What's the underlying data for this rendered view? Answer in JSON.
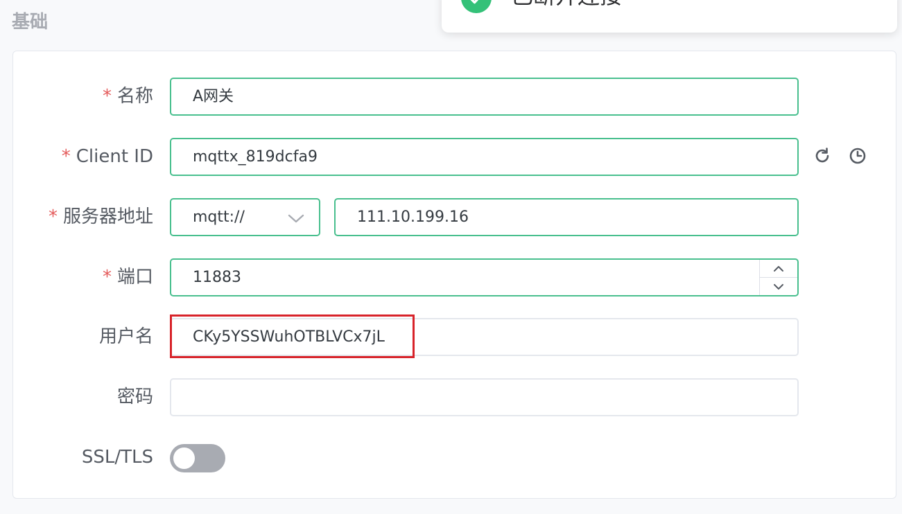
{
  "section": {
    "title": "基础"
  },
  "toast": {
    "message": "已断开连接",
    "icon": "check-circle-icon",
    "close_icon": "close-icon",
    "accent": "#34c178"
  },
  "form": {
    "name": {
      "required_mark": "*",
      "label": "名称",
      "value": "A网关"
    },
    "client_id": {
      "required_mark": "*",
      "label": "Client ID",
      "value": "mqttx_819dcfa9",
      "refresh_icon": "refresh-icon",
      "history_icon": "clock-icon"
    },
    "host": {
      "required_mark": "*",
      "label": "服务器地址",
      "protocol": "mqtt://",
      "address": "111.10.199.16"
    },
    "port": {
      "required_mark": "*",
      "label": "端口",
      "value": "11883"
    },
    "username": {
      "label": "用户名",
      "value": "CKy5YSSWuhOTBLVCx7jL"
    },
    "password": {
      "label": "密码",
      "value": ""
    },
    "ssl": {
      "label": "SSL/TLS",
      "enabled": false
    }
  },
  "colors": {
    "focus_border": "#48bf8e",
    "required": "#e45b5b",
    "highlight_box": "#d8232a",
    "toggle_off": "#a8abb2"
  }
}
